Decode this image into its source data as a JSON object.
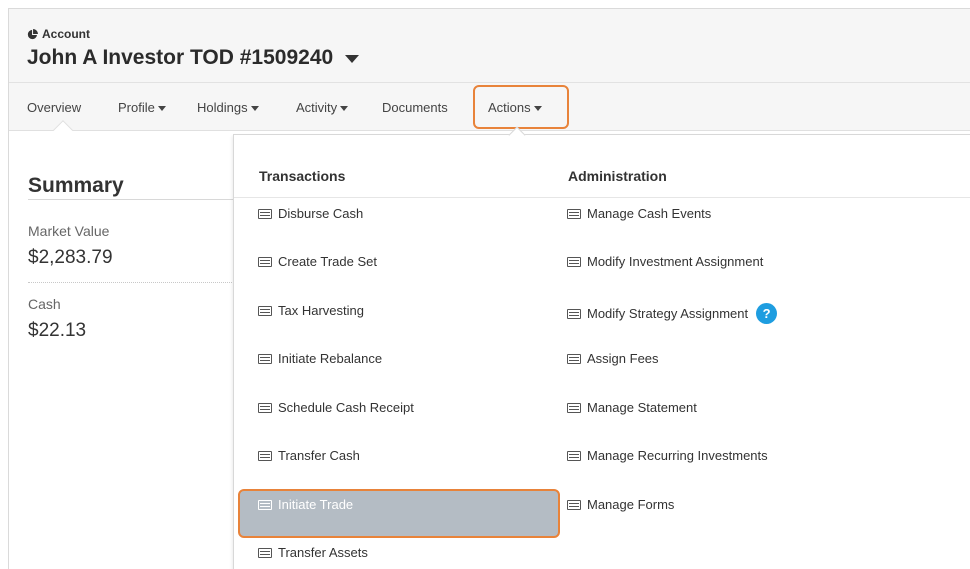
{
  "account": {
    "label": "Account",
    "name": "John A Investor TOD #1509240"
  },
  "nav": {
    "items": [
      {
        "label": "Overview"
      },
      {
        "label": "Profile"
      },
      {
        "label": "Holdings"
      },
      {
        "label": "Activity"
      },
      {
        "label": "Documents"
      },
      {
        "label": "Actions"
      }
    ]
  },
  "summary": {
    "title": "Summary",
    "market_value_label": "Market Value",
    "market_value": "$2,283.79",
    "cash_label": "Cash",
    "cash": "$22.13"
  },
  "menu": {
    "transactions": {
      "heading": "Transactions",
      "items": [
        {
          "label": "Disburse Cash"
        },
        {
          "label": "Create Trade Set"
        },
        {
          "label": "Tax Harvesting"
        },
        {
          "label": "Initiate Rebalance"
        },
        {
          "label": "Schedule Cash Receipt"
        },
        {
          "label": "Transfer Cash"
        },
        {
          "label": "Initiate Trade"
        },
        {
          "label": "Transfer Assets"
        }
      ]
    },
    "administration": {
      "heading": "Administration",
      "items": [
        {
          "label": "Manage Cash Events"
        },
        {
          "label": "Modify Investment Assignment"
        },
        {
          "label": "Modify Strategy Assignment"
        },
        {
          "label": "Assign Fees"
        },
        {
          "label": "Manage Statement"
        },
        {
          "label": "Manage Recurring Investments"
        },
        {
          "label": "Manage Forms"
        }
      ]
    },
    "help_glyph": "?"
  },
  "colors": {
    "highlight_border": "#e8833a",
    "highlight_bg": "#b4bcc4",
    "help_badge": "#1e9de0"
  }
}
